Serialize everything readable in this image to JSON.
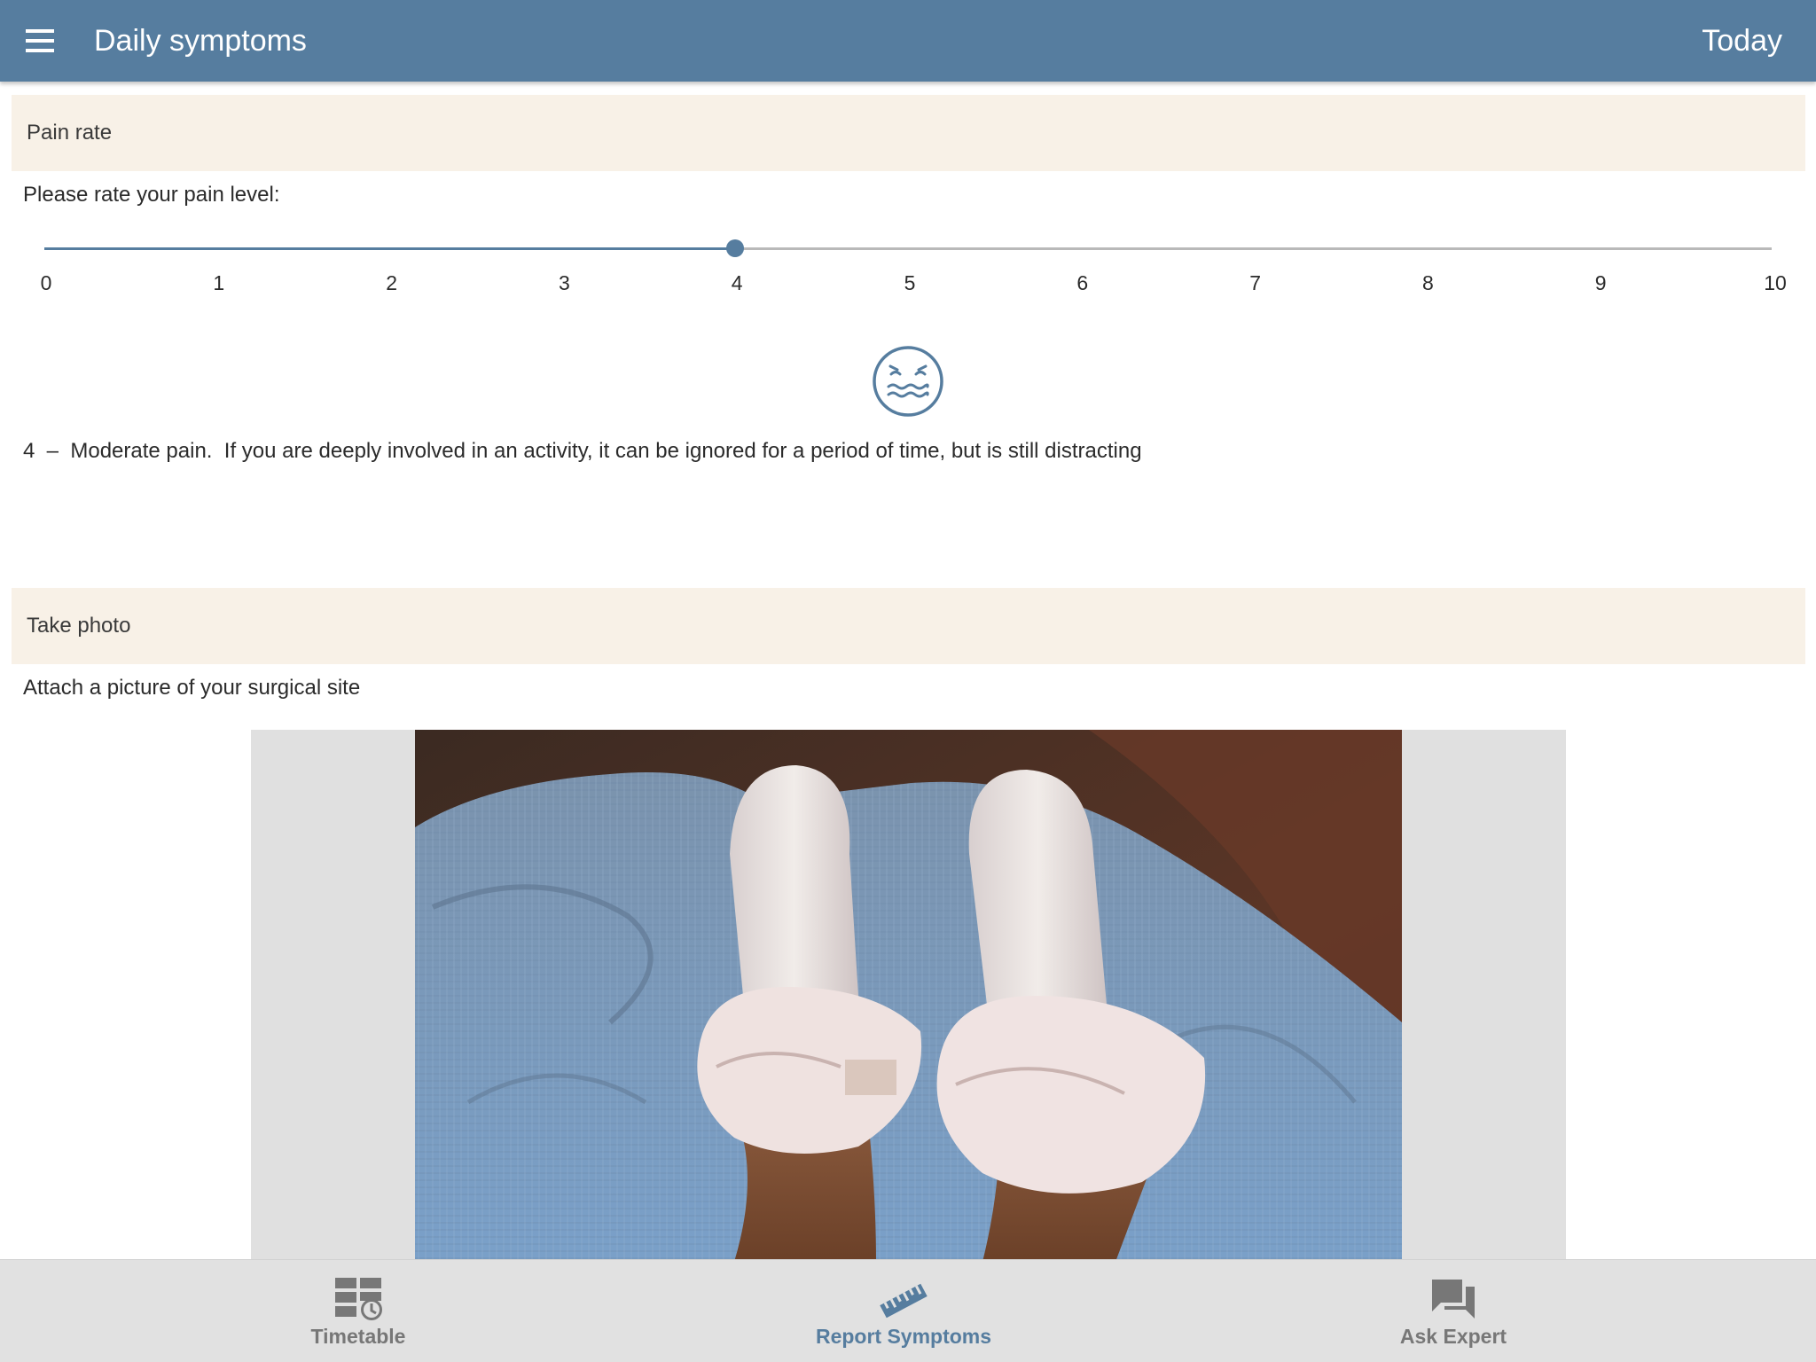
{
  "header": {
    "title": "Daily symptoms",
    "today_label": "Today"
  },
  "pain_section": {
    "header": "Pain rate",
    "prompt": "Please rate your pain level:",
    "slider": {
      "min": 0,
      "max": 10,
      "value": 4,
      "ticks": [
        "0",
        "1",
        "2",
        "3",
        "4",
        "5",
        "6",
        "7",
        "8",
        "9",
        "10"
      ]
    },
    "face_icon": "grimacing-face-icon",
    "description": "4  –  Moderate pain.  If you are deeply involved in an activity, it can be ignored for a period of time, but is still distracting"
  },
  "photo_section": {
    "header": "Take photo",
    "prompt": "Attach a picture of your surgical site"
  },
  "bottom_nav": {
    "items": [
      {
        "label": "Timetable",
        "icon": "timetable-icon",
        "active": false
      },
      {
        "label": "Report Symptoms",
        "icon": "ruler-icon",
        "active": true
      },
      {
        "label": "Ask Expert",
        "icon": "chat-icon",
        "active": false
      }
    ]
  },
  "colors": {
    "primary": "#567d9f",
    "section_bg": "#f8f1e7",
    "nav_bg": "#e1e1e1",
    "inactive": "#777777"
  }
}
